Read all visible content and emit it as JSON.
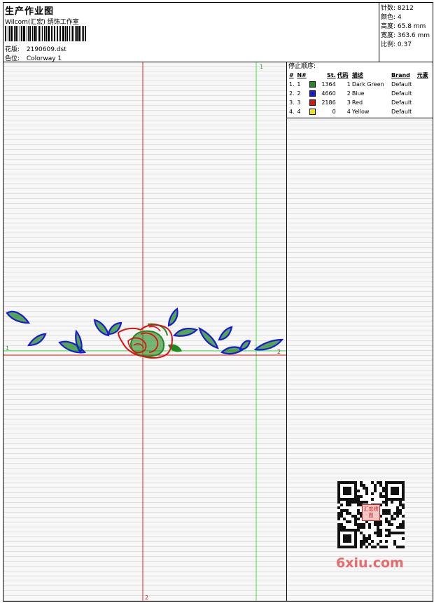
{
  "header": {
    "title": "生产作业图",
    "company": "Wilcom(汇宏) 绣饰工作室",
    "design_label": "花版:",
    "design_value": "2190609.dst",
    "colorway_label": "色位:",
    "colorway_value": "Colorway 1"
  },
  "stats": {
    "stitches": "针数: 8212",
    "colors": "颜色: 4",
    "height": "高度: 65.8 mm",
    "width": "宽度: 363.6 mm",
    "scale": "比例: 0.37"
  },
  "axes": {
    "green_vertical_label": "1",
    "green_horizontal_label": "1",
    "red_horizontal_label": "2",
    "red_vertical_label": "2"
  },
  "stop_sequence": {
    "title": "停止顺序:",
    "headers": [
      "#",
      "N#",
      "St.",
      "代码",
      "描述",
      "Brand",
      "元素"
    ],
    "rows": [
      {
        "idx": "1.",
        "n": "1",
        "swatch": "#1e8a1e",
        "st": "1364",
        "code": "1",
        "desc": "Dark Green",
        "brand": "Default",
        "elem": ""
      },
      {
        "idx": "2.",
        "n": "2",
        "swatch": "#1a1ad6",
        "st": "4660",
        "code": "2",
        "desc": "Blue",
        "brand": "Default",
        "elem": ""
      },
      {
        "idx": "3.",
        "n": "3",
        "swatch": "#e01010",
        "st": "2186",
        "code": "3",
        "desc": "Red",
        "brand": "Default",
        "elem": ""
      },
      {
        "idx": "4.",
        "n": "4",
        "swatch": "#f4e400",
        "st": "0",
        "code": "4",
        "desc": "Yellow",
        "brand": "Default",
        "elem": ""
      }
    ]
  },
  "colors": {
    "dark_green": "#1e8a1e",
    "blue": "#1a1ad6",
    "red": "#e01010",
    "guide_green": "#44dd44",
    "guide_red": "#e02020"
  },
  "qr": {
    "stamp_text": "汇宏绣图",
    "watermark": "6xiu.com"
  }
}
